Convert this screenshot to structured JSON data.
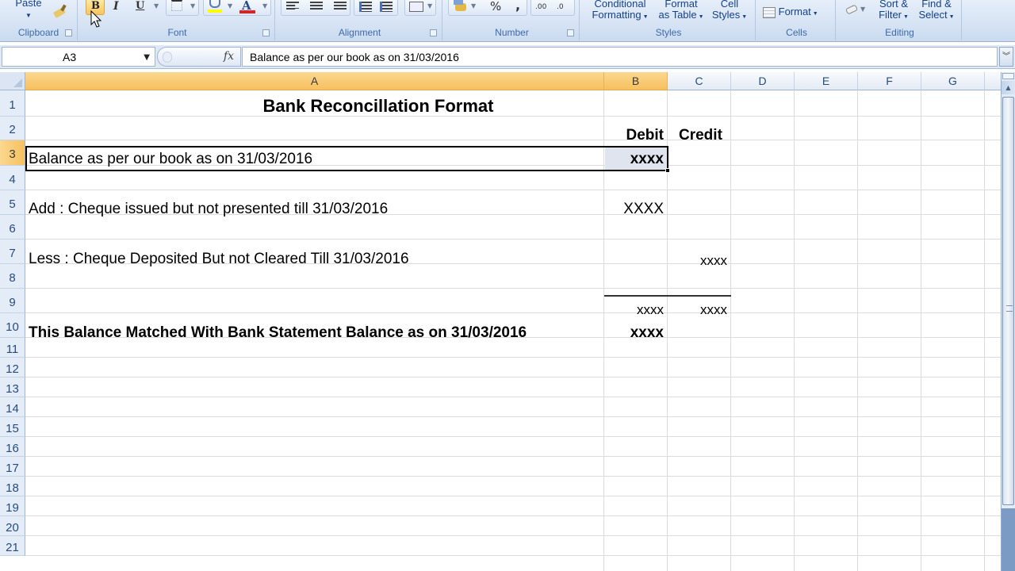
{
  "ribbon": {
    "groups": [
      {
        "name": "clipboard",
        "label": "Clipboard"
      },
      {
        "name": "font",
        "label": "Font"
      },
      {
        "name": "alignment",
        "label": "Alignment"
      },
      {
        "name": "number",
        "label": "Number"
      },
      {
        "name": "styles",
        "label": "Styles"
      },
      {
        "name": "cells",
        "label": "Cells"
      },
      {
        "name": "editing",
        "label": "Editing"
      }
    ],
    "clipboard": {
      "paste": "Paste"
    },
    "font": {
      "bold": "B",
      "italic": "I",
      "underline": "U",
      "fill_color_hex": "#ffff00",
      "font_color_hex": "#e02020",
      "font_color_glyph": "A"
    },
    "number": {
      "percent": "%",
      "comma": ",",
      "inc_decimal": ".00",
      "dec_decimal": ".0"
    },
    "styles": {
      "conditional_formatting": [
        "Conditional",
        "Formatting"
      ],
      "format_as_table": [
        "Format",
        "as Table"
      ],
      "cell_styles": [
        "Cell",
        "Styles"
      ]
    },
    "cells": {
      "format": "Format"
    },
    "editing": {
      "sort_filter": [
        "Sort &",
        "Filter"
      ],
      "find_select": [
        "Find &",
        "Select"
      ]
    }
  },
  "formula_bar": {
    "name_box": "A3",
    "fx_label": "fx",
    "content": "Balance as per our book as on 31/03/2016"
  },
  "sheet": {
    "columns": [
      "A",
      "B",
      "C",
      "D",
      "E",
      "F",
      "G"
    ],
    "selected_column": [
      "A",
      "B"
    ],
    "rows": [
      "1",
      "2",
      "3",
      "4",
      "5",
      "6",
      "7",
      "8",
      "9",
      "10",
      "11",
      "12",
      "13",
      "14",
      "15",
      "16",
      "17",
      "18",
      "19",
      "20",
      "21"
    ],
    "selected_row": "3",
    "selected_range": "A3:B3",
    "cells": {
      "A1": "Bank Reconcillation Format",
      "B2": "Debit",
      "C2": "Credit",
      "A3": "Balance as per our book as on 31/03/2016",
      "B3": "xxxx",
      "A5": "Add : Cheque issued but not presented till 31/03/2016",
      "B5": "XXXX",
      "A7": "Less : Cheque Deposited But not Cleared Till 31/03/2016",
      "C7": "xxxx",
      "B9": "xxxx",
      "C9": "xxxx",
      "A10": "This Balance Matched With Bank Statement Balance as on 31/03/2016",
      "B10": "xxxx"
    }
  },
  "colors": {
    "selected_header": "#f7c05f",
    "ribbon_label": "#3e6aaa",
    "header_text": "#274b7f"
  }
}
